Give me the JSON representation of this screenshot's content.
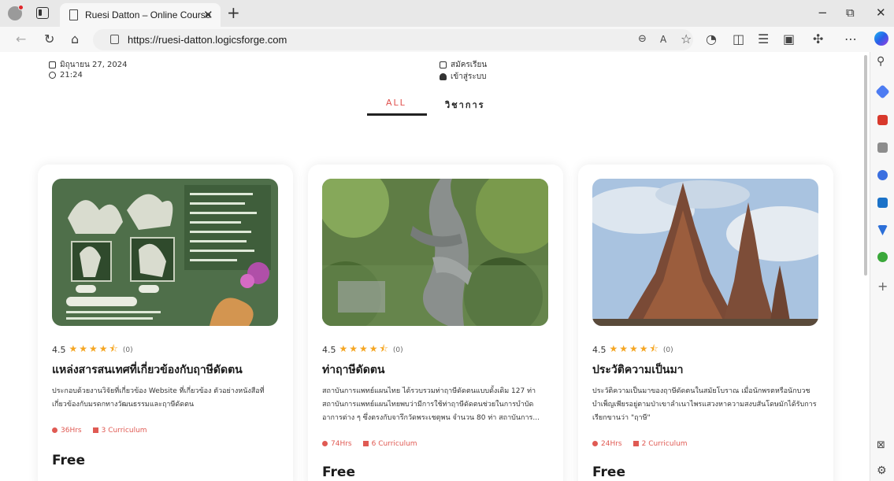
{
  "browser": {
    "tab_title": "Ruesi Datton – Online Course",
    "url": "https://ruesi-datton.logicsforge.com",
    "window_buttons": [
      "−",
      "⧉",
      "✕"
    ]
  },
  "header": {
    "date": "มิถุนายน 27, 2024",
    "time": "21:24",
    "register": "สมัครเรียน",
    "login": "เข้าสู่ระบบ"
  },
  "filters": [
    "ALL",
    "วิชาการ"
  ],
  "courses": [
    {
      "rating": "4.5",
      "stars": 4.5,
      "reviews": "(0)",
      "title": "แหล่งสารสนเทศที่เกี่ยวข้องกับฤาษีดัดตน",
      "desc": "ประกอบด้วยงานวิจัยที่เกี่ยวข้อง Website ที่เกี่ยวข้อง ตัวอย่างหนังสือที่เกี่ยวข้องกับมรดกทางวัฒนธรรมและฤาษีดัดตน",
      "hours": "36Hrs",
      "curriculum": "3 Curriculum",
      "price": "Free"
    },
    {
      "rating": "4.5",
      "stars": 4.5,
      "reviews": "(0)",
      "title": "ท่าฤาษีดัดตน",
      "desc": "สถาบันการแพทย์แผนไทย ได้รวบรวมท่าฤาษีดัดตนแบบดั้งเดิม 127 ท่า สถาบันการแพทย์แผนไทยพบว่ามีการใช้ท่าฤาษีดัดตนช่วยในการบำบัดอาการต่าง ๆ ซึ่งตรงกับจารึกวัดพระเชตุพน จำนวน 80 ท่า สถาบันการ...",
      "hours": "74Hrs",
      "curriculum": "6 Curriculum",
      "price": "Free"
    },
    {
      "rating": "4.5",
      "stars": 4.5,
      "reviews": "(0)",
      "title": "ประวัติความเป็นมา",
      "desc": "ประวัติความเป็นมาของฤาษีดัดตนในสมัยโบราณ เมื่อนักพรตหรือนักบวชบำเพ็ญเพียรอยู่ตามป่าเขาลำเนาไพรแสวงหาความสงบสันโดษมักได้รับการเรียกขานว่า \"ฤาษี\"",
      "hours": "24Hrs",
      "curriculum": "2 Curriculum",
      "price": "Free"
    }
  ]
}
